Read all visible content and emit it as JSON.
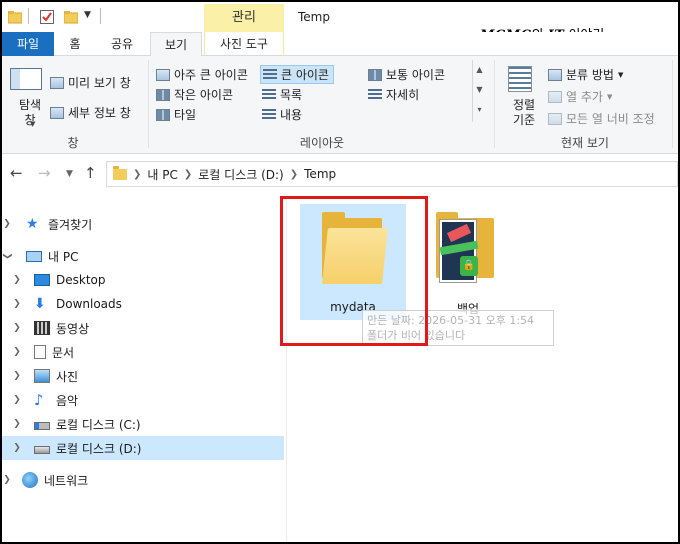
{
  "titlebar": {
    "manage_tab": "관리",
    "window_title": "Temp",
    "watermark_brand": "MCMC",
    "watermark_mid": "의 ",
    "watermark_it": "IT",
    "watermark_tail": " 이야기"
  },
  "tabs": {
    "file": "파일",
    "home": "홈",
    "share": "공유",
    "view": "보기",
    "photo_tools": "사진 도구"
  },
  "ribbon": {
    "pane_group": {
      "nav_pane": "탐색\n창",
      "preview": "미리 보기 창",
      "details": "세부 정보 창",
      "label": "창"
    },
    "layout_group": {
      "extra_large": "아주 큰 아이콘",
      "large": "큰 아이콘",
      "medium": "보통 아이콘",
      "small": "작은 아이콘",
      "list": "목록",
      "details": "자세히",
      "tiles": "타일",
      "content": "내용",
      "label": "레이아웃"
    },
    "current_view_group": {
      "sort": "정렬\n기준",
      "group_by": "분류 방법",
      "add_columns": "열 추가",
      "fit_columns": "모든 열 너비 조정",
      "label": "현재 보기"
    }
  },
  "address": {
    "crumbs": [
      "내 PC",
      "로컬 디스크 (D:)",
      "Temp"
    ]
  },
  "navpane": {
    "items": [
      {
        "label": "즐겨찾기"
      },
      {
        "label": "내 PC"
      },
      {
        "label": "Desktop"
      },
      {
        "label": "Downloads"
      },
      {
        "label": "동영상"
      },
      {
        "label": "문서"
      },
      {
        "label": "사진"
      },
      {
        "label": "음악"
      },
      {
        "label": "로컬 디스크 (C:)"
      },
      {
        "label": "로컬 디스크 (D:)"
      },
      {
        "label": "네트워크"
      }
    ]
  },
  "content": {
    "items": [
      {
        "name": "mydata"
      },
      {
        "name": "백업"
      }
    ],
    "tooltip_line1": "만든 날짜: 2026-05-31 오후 1:54",
    "tooltip_line2": "폴더가 비어 있습니다"
  },
  "colors": {
    "accent": "#1a6fc1",
    "selection": "#cce8ff",
    "highlight_box": "#e01a1a",
    "manage_tab_bg": "#fbf0a8"
  }
}
